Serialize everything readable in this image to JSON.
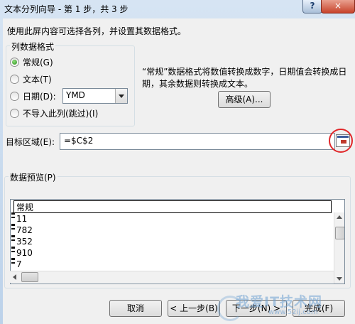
{
  "window": {
    "title": "文本分列向导 - 第 1 步，共 3 步",
    "help_label": "?",
    "close_label": "×"
  },
  "intro_text": "使用此屏内容可选择各列，并设置其数据格式。",
  "column_format": {
    "group_title": "列数据格式",
    "options": [
      {
        "label": "常规(G)",
        "checked": true
      },
      {
        "label": "文本(T)",
        "checked": false
      },
      {
        "label": "日期(D):",
        "checked": false
      },
      {
        "label": "不导入此列(跳过)(I)",
        "checked": false
      }
    ],
    "date_format_value": "YMD"
  },
  "description": "“常规”数据格式将数值转换成数字，日期值会转换成日期，其余数据则转换成文本。",
  "advanced_button": "高级(A)...",
  "destination": {
    "label": "目标区域(E):",
    "value": "=$C$2"
  },
  "preview": {
    "group_title": "数据预览(P)",
    "header": "常规",
    "rows": [
      "11",
      "782",
      "352",
      "910",
      "7"
    ]
  },
  "buttons": {
    "cancel": "取消",
    "back": "< 上一步(B)",
    "next": "下一步(N) >",
    "finish": "完成(F)"
  },
  "watermark": {
    "text": "我爱IT技术网",
    "url": "www.52ij.com"
  },
  "colors": {
    "accent_circle": "#e0272a",
    "title_gradient_top": "#d6e4f3",
    "close_button": "#c7432b"
  }
}
